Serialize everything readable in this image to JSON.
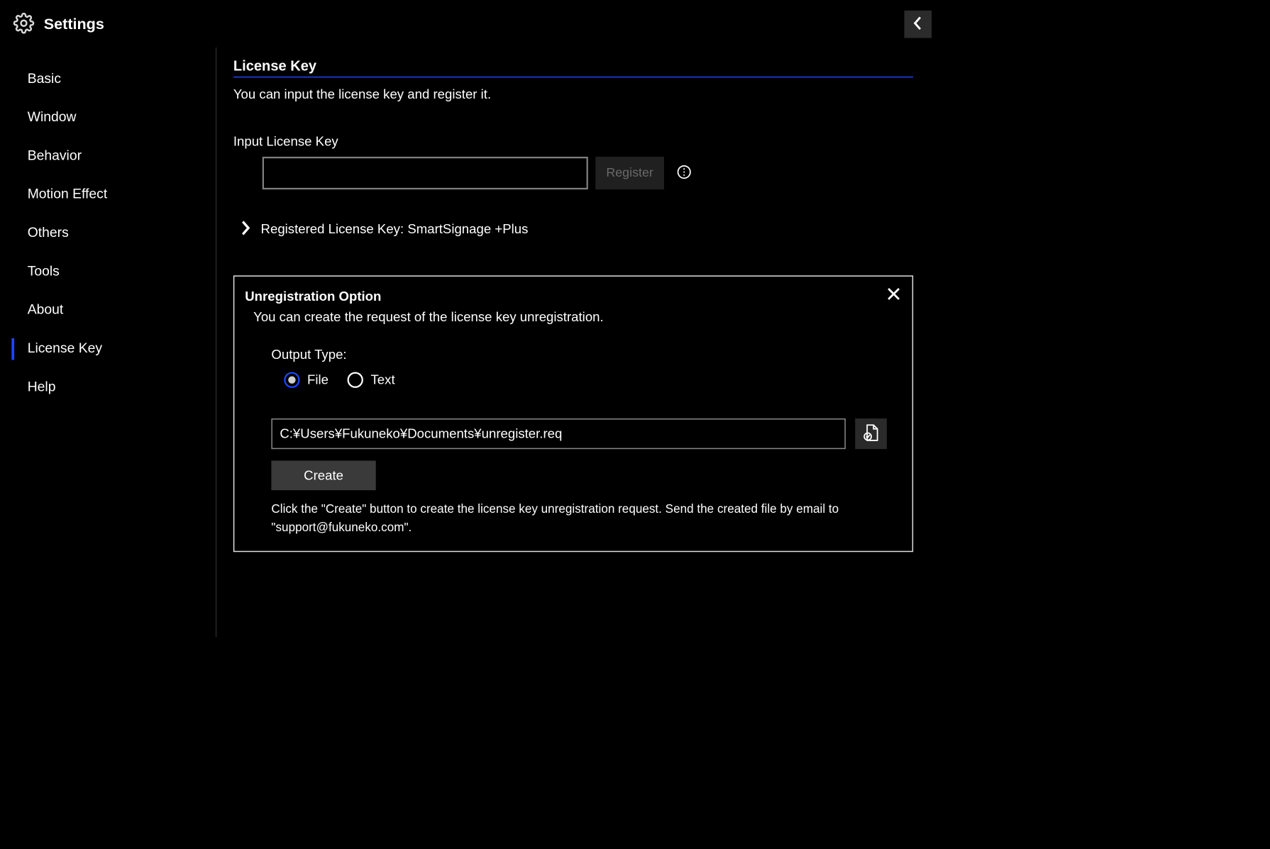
{
  "header": {
    "title": "Settings"
  },
  "sidebar": {
    "items": [
      {
        "label": "Basic"
      },
      {
        "label": "Window"
      },
      {
        "label": "Behavior"
      },
      {
        "label": "Motion Effect"
      },
      {
        "label": "Others"
      },
      {
        "label": "Tools"
      },
      {
        "label": "About"
      },
      {
        "label": "License Key"
      },
      {
        "label": "Help"
      }
    ],
    "active_index": 7
  },
  "main": {
    "section_title": "License Key",
    "section_desc": "You can input the license key and register it.",
    "input_label": "Input License Key",
    "input_value": "",
    "register_label": "Register",
    "registered_label": "Registered License Key: ",
    "registered_value": "SmartSignage +Plus",
    "panel": {
      "title": "Unregistration Option",
      "desc": "You can create the request of the license key unregistration.",
      "output_label": "Output Type:",
      "radio_file": "File",
      "radio_text": "Text",
      "selected_radio": "file",
      "path_value": "C:¥Users¥Fukuneko¥Documents¥unregister.req",
      "create_label": "Create",
      "hint": "Click the \"Create\" button to create the license key unregistration request. Send the created file by email to \"support@fukuneko.com\"."
    }
  }
}
